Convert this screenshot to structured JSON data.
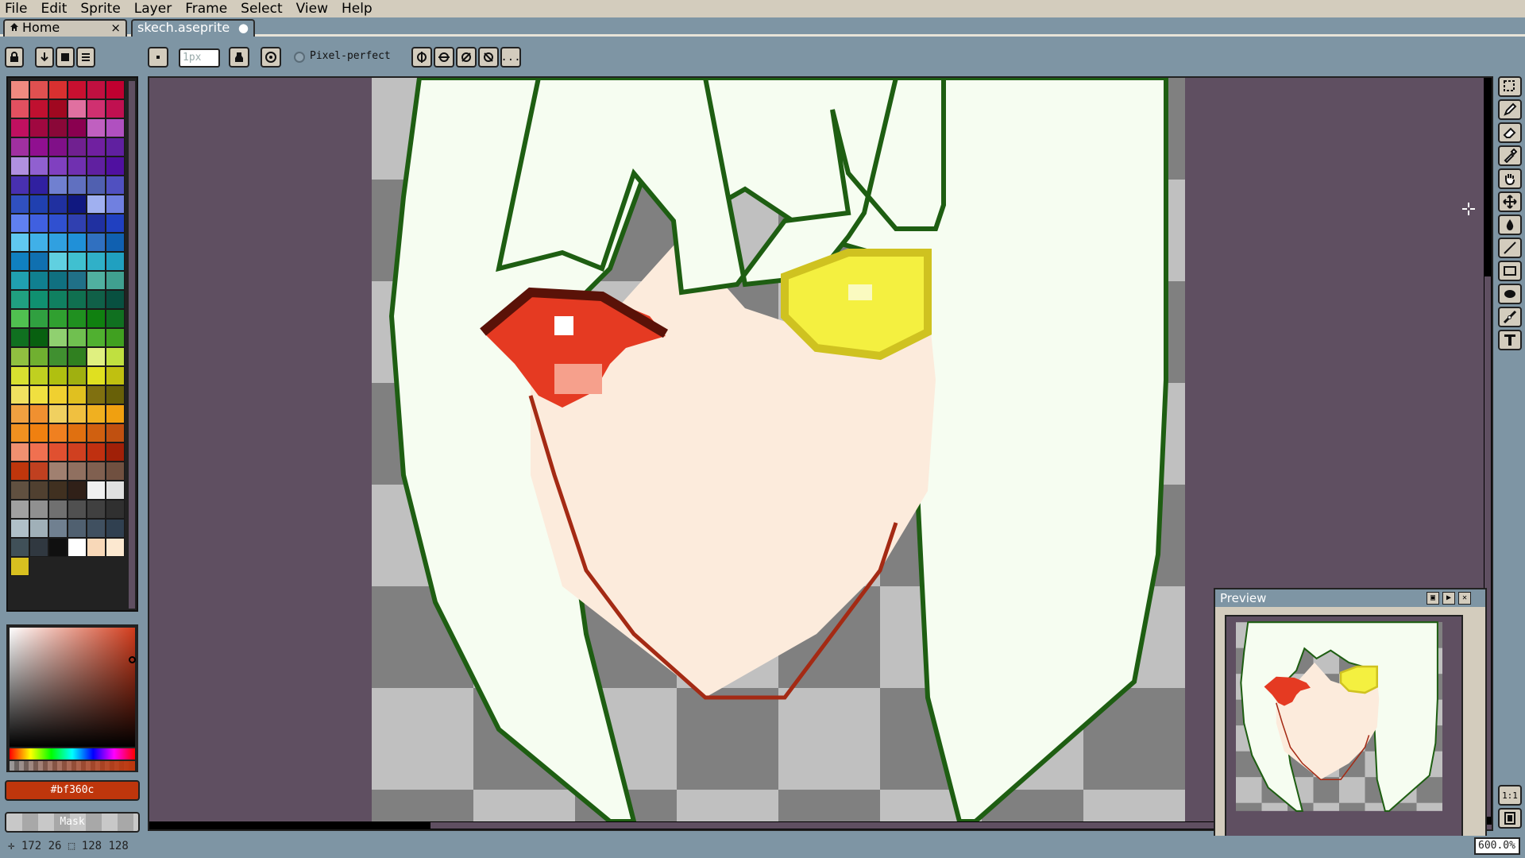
{
  "menus": [
    "File",
    "Edit",
    "Sprite",
    "Layer",
    "Frame",
    "Select",
    "View",
    "Help"
  ],
  "tabs": {
    "home": {
      "label": "Home",
      "close": "×"
    },
    "sketch": {
      "label": "skech.aseprite",
      "state": "●"
    }
  },
  "toolbar": {
    "brush_size_value": "1px",
    "pixel_perfect_label": "Pixel-perfect",
    "more_label": "..."
  },
  "palette": {
    "colors": [
      "#f08a80",
      "#e05050",
      "#d93030",
      "#c81030",
      "#c01040",
      "#c00030",
      "#e25060",
      "#c01030",
      "#a00820",
      "#e070a0",
      "#d03070",
      "#c01050",
      "#c01060",
      "#a00840",
      "#8a0838",
      "#8a0050",
      "#c060c0",
      "#b050c0",
      "#a030a0",
      "#901090",
      "#801088",
      "#702090",
      "#7020a0",
      "#6020a0",
      "#b090e0",
      "#9060d0",
      "#8040c0",
      "#7030b0",
      "#6020a0",
      "#5010a0",
      "#4830b0",
      "#3020a0",
      "#7080d0",
      "#6070c0",
      "#5060b0",
      "#5050c0",
      "#3050c0",
      "#2040b0",
      "#2030a0",
      "#101880",
      "#a0b0f0",
      "#7080e0",
      "#6080f0",
      "#4060e0",
      "#3050d0",
      "#3040b0",
      "#2030a0",
      "#2040c0",
      "#60c8f0",
      "#40b0e8",
      "#30a0e0",
      "#2090d8",
      "#3070c0",
      "#1060b0",
      "#1080c0",
      "#1070b0",
      "#60d0e0",
      "#40c0d0",
      "#30b0c8",
      "#20a0c0",
      "#20a0b0",
      "#108090",
      "#107080",
      "#207088",
      "#50b0a0",
      "#40a090",
      "#20a080",
      "#109070",
      "#108060",
      "#107050",
      "#106048",
      "#085040",
      "#50c050",
      "#30a040",
      "#30a030",
      "#209020",
      "#108010",
      "#107020",
      "#107020",
      "#086010",
      "#90d070",
      "#70c050",
      "#50b030",
      "#40a020",
      "#90c040",
      "#70b030",
      "#409030",
      "#308020",
      "#e0f080",
      "#c0e040",
      "#d8e030",
      "#c0d020",
      "#b0c010",
      "#a0b010",
      "#e0e020",
      "#c0c010",
      "#f0e060",
      "#f0e040",
      "#f0d030",
      "#e0c020",
      "#807010",
      "#686008",
      "#f0a040",
      "#f09030",
      "#f0d060",
      "#f0c040",
      "#f0b020",
      "#f0a010",
      "#f09020",
      "#f08010",
      "#f08020",
      "#e07010",
      "#d06010",
      "#c05010",
      "#f09070",
      "#f07050",
      "#e05030",
      "#d04020",
      "#c03010",
      "#a02008",
      "#bf360c",
      "#c04020",
      "#a08070",
      "#907060",
      "#806050",
      "#705040",
      "#605040",
      "#504030",
      "#403020",
      "#302018",
      "#f0f0f0",
      "#e0e0e0",
      "#a0a0a0",
      "#909090",
      "#707070",
      "#505050",
      "#404040",
      "#303030",
      "#b0c0c8",
      "#a0b0b8",
      "#708090",
      "#506070",
      "#405060",
      "#304050",
      "#405058",
      "#303840",
      "#101010",
      "#ffffff",
      "#f8d8b8",
      "#fce8d0",
      "#d8c020"
    ]
  },
  "color": {
    "foreground_hex": "#bf360c",
    "mask_label": "Mask"
  },
  "status": {
    "position": "172 26",
    "size": "128 128",
    "zoom": "600.0%"
  },
  "preview": {
    "title": "Preview"
  },
  "tools": [
    "marquee-icon",
    "pencil-icon",
    "eraser-icon",
    "eyedropper-icon",
    "hand-icon",
    "move-icon",
    "paint-bucket-icon",
    "line-icon",
    "rectangle-icon",
    "ellipse-icon",
    "blur-icon",
    "text-icon"
  ],
  "tool_bottom": {
    "one_to_one": "1:1"
  }
}
